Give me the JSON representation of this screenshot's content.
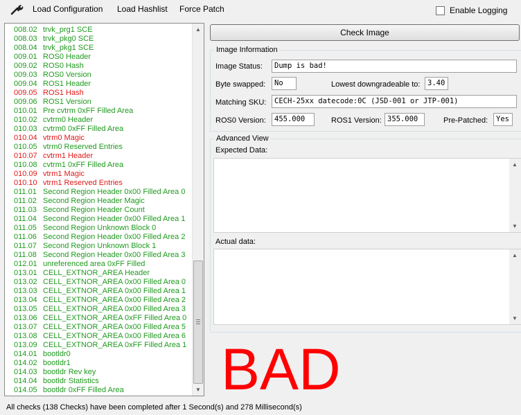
{
  "menubar": {
    "tool_icon": "wrench-icon",
    "items": [
      "Load Configuration",
      "Load Hashlist",
      "Force Patch"
    ],
    "enable_logging_label": "Enable Logging",
    "enable_logging_checked": false
  },
  "checks": [
    {
      "id": "008.02",
      "name": "trvk_prg1 SCE",
      "status": "ok"
    },
    {
      "id": "008.03",
      "name": "trvk_pkg0 SCE",
      "status": "ok"
    },
    {
      "id": "008.04",
      "name": "trvk_pkg1 SCE",
      "status": "ok"
    },
    {
      "id": "009.01",
      "name": "ROS0 Header",
      "status": "ok"
    },
    {
      "id": "009.02",
      "name": "ROS0 Hash",
      "status": "ok"
    },
    {
      "id": "009.03",
      "name": "ROS0 Version",
      "status": "ok"
    },
    {
      "id": "009.04",
      "name": "ROS1 Header",
      "status": "ok"
    },
    {
      "id": "009.05",
      "name": "ROS1 Hash",
      "status": "fail"
    },
    {
      "id": "009.06",
      "name": "ROS1 Version",
      "status": "ok"
    },
    {
      "id": "010.01",
      "name": "Pre cvtrm 0xFF Filled Area",
      "status": "ok"
    },
    {
      "id": "010.02",
      "name": "cvtrm0 Header",
      "status": "ok"
    },
    {
      "id": "010.03",
      "name": "cvtrm0 0xFF Filled Area",
      "status": "ok"
    },
    {
      "id": "010.04",
      "name": "vtrm0 Magic",
      "status": "fail"
    },
    {
      "id": "010.05",
      "name": "vtrm0 Reserved Entries",
      "status": "ok"
    },
    {
      "id": "010.07",
      "name": "cvtrm1 Header",
      "status": "fail"
    },
    {
      "id": "010.08",
      "name": "cvtrm1 0xFF Filled Area",
      "status": "ok"
    },
    {
      "id": "010.09",
      "name": "vtrm1 Magic",
      "status": "fail"
    },
    {
      "id": "010.10",
      "name": "vtrm1 Reserved Entries",
      "status": "fail"
    },
    {
      "id": "011.01",
      "name": "Second Region Header 0x00 Filled Area 0",
      "status": "ok"
    },
    {
      "id": "011.02",
      "name": "Second Region Header Magic",
      "status": "ok"
    },
    {
      "id": "011.03",
      "name": "Second Region Header Count",
      "status": "ok"
    },
    {
      "id": "011.04",
      "name": "Second Region Header 0x00 Filled Area 1",
      "status": "ok"
    },
    {
      "id": "011.05",
      "name": "Second Region Unknown Block 0",
      "status": "ok"
    },
    {
      "id": "011.06",
      "name": "Second Region Header 0x00 Filled Area 2",
      "status": "ok"
    },
    {
      "id": "011.07",
      "name": "Second Region Unknown Block 1",
      "status": "ok"
    },
    {
      "id": "011.08",
      "name": "Second Region Header 0x00 Filled Area 3",
      "status": "ok"
    },
    {
      "id": "012.01",
      "name": "unreferenced area 0xFF Filled",
      "status": "ok"
    },
    {
      "id": "013.01",
      "name": "CELL_EXTNOR_AREA Header",
      "status": "ok"
    },
    {
      "id": "013.02",
      "name": "CELL_EXTNOR_AREA 0x00 Filled Area 0",
      "status": "ok"
    },
    {
      "id": "013.03",
      "name": "CELL_EXTNOR_AREA 0x00 Filled Area 1",
      "status": "ok"
    },
    {
      "id": "013.04",
      "name": "CELL_EXTNOR_AREA 0x00 Filled Area 2",
      "status": "ok"
    },
    {
      "id": "013.05",
      "name": "CELL_EXTNOR_AREA 0x00 Filled Area 3",
      "status": "ok"
    },
    {
      "id": "013.06",
      "name": "CELL_EXTNOR_AREA 0xFF Filled Area 0",
      "status": "ok"
    },
    {
      "id": "013.07",
      "name": "CELL_EXTNOR_AREA 0x00 Filled Area 5",
      "status": "ok"
    },
    {
      "id": "013.08",
      "name": "CELL_EXTNOR_AREA 0x00 Filled Area 6",
      "status": "ok"
    },
    {
      "id": "013.09",
      "name": "CELL_EXTNOR_AREA 0xFF Filled Area 1",
      "status": "ok"
    },
    {
      "id": "014.01",
      "name": "bootldr0",
      "status": "ok"
    },
    {
      "id": "014.02",
      "name": "bootldr1",
      "status": "ok"
    },
    {
      "id": "014.03",
      "name": "bootldr Rev key",
      "status": "ok"
    },
    {
      "id": "014.04",
      "name": "bootldr Statistics",
      "status": "ok"
    },
    {
      "id": "014.05",
      "name": "bootldr 0xFF Filled Area",
      "status": "ok"
    }
  ],
  "status_colors": {
    "ok": "#1f9a1f",
    "fail": "#e01a1a",
    "verdict": "#ff0000"
  },
  "check_button_label": "Check Image",
  "image_info": {
    "title": "Image Information",
    "image_status_label": "Image Status:",
    "image_status_value": "Dump is bad!",
    "byte_swapped_label": "Byte swapped:",
    "byte_swapped_value": "No",
    "lowest_downgradeable_label": "Lowest downgradeable to:",
    "lowest_downgradeable_value": "3.40",
    "matching_sku_label": "Matching SKU:",
    "matching_sku_value": "CECH-25xx datecode:0C (JSD-001 or JTP-001)",
    "ros0_version_label": "ROS0 Version:",
    "ros0_version_value": "455.000",
    "ros1_version_label": "ROS1 Version:",
    "ros1_version_value": "355.000",
    "pre_patched_label": "Pre-Patched:",
    "pre_patched_value": "Yes"
  },
  "advanced_view": {
    "title": "Advanced View",
    "expected_label": "Expected Data:",
    "actual_label": "Actual data:"
  },
  "verdict": "BAD",
  "status_bar": "All checks (138 Checks) have been completed after 1 Second(s) and 278 Millisecond(s)"
}
